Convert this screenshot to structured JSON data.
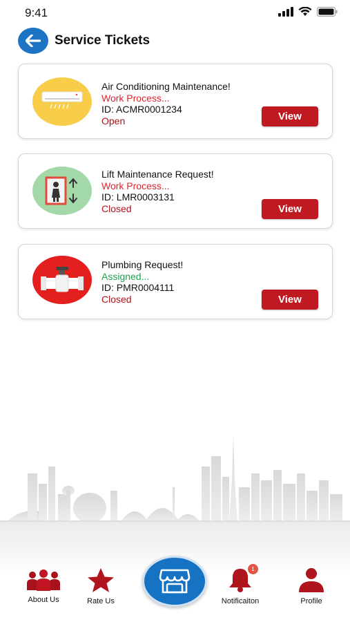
{
  "status_bar": {
    "time": "9:41"
  },
  "header": {
    "title": "Service Tickets"
  },
  "tickets": [
    {
      "title": "Air Conditioning Maintenance!",
      "state": "Work Process...",
      "id": "ID: ACMR0001234",
      "status": "Open",
      "view_label": "View",
      "icon": "air-conditioner-icon",
      "icon_bg": "#f7cd4a"
    },
    {
      "title": "Lift Maintenance Request!",
      "state": "Work Process...",
      "id": "ID: LMR0003131",
      "status": "Closed",
      "view_label": "View",
      "icon": "elevator-icon",
      "icon_bg": "#a3d9a8"
    },
    {
      "title": "Plumbing Request!",
      "state": "Assigned...",
      "id": "ID: PMR0004111",
      "status": "Closed",
      "view_label": "View",
      "icon": "pipe-valve-icon",
      "icon_bg": "#e3201d"
    }
  ],
  "bottom_nav": {
    "about_us": "About Us",
    "rate_us": "Rate Us",
    "notification": "Notificaiton",
    "notification_badge": "1",
    "profile": "Profile"
  },
  "colors": {
    "accent_blue": "#1d74c5",
    "view_button": "#bf1a22",
    "state_red": "#e0232c",
    "state_green": "#1ea34b",
    "nav_icon": "#a8121b"
  }
}
